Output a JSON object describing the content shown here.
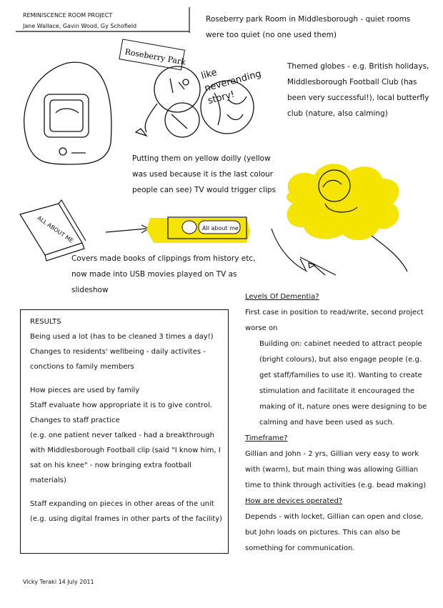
{
  "header": {
    "title": "REMINISCENCE ROOM PROJECT",
    "authors": "Jane Wallace, Gavin Wood, Gy Schofield"
  },
  "intro": "Roseberry park Room in Middlesborough - quiet rooms were too quiet (no one used them)",
  "sign_label": "Roseberry Park",
  "exclaim": "like neverending story!",
  "globes_note": "Themed globes - e.g. British holidays, Middlesborough Football Club (has been very successful!), local butterfly club (nature, also calming)",
  "doily_note": "Putting them on yellow doilly (yellow was used because it is the last colour people can see) TV would trigger clips",
  "book_label": "ALL ABOUT ME",
  "usb_label": "All about me",
  "covers_note": "Covers made books of clippings from history etc, now made into USB movies played on TV as slideshow",
  "results": {
    "heading": "RESULTS",
    "lines": [
      "Being used a lot (has to be cleaned 3 times a day!)",
      "Changes to residents' wellbeing - daily activites - conctions to family members",
      "",
      "How pieces are used by family",
      "Staff evaluate how appropriate it is to give control.",
      "Changes to staff practice",
      "(e.g. one patient never talked - had a breakthrough with Middlesborough Football clip (said \"I know him, I sat on his knee\" - now bringing extra football materials)",
      "",
      "Staff expanding on pieces in other areas of the unit (e.g. using digital frames in other parts of the facility)"
    ]
  },
  "dementia": {
    "heading": "Levels Of Dementia?",
    "text": "First case in position to read/write, second project worse on",
    "building": "Building on: cabinet needed to attract people (bright colours), but also engage people (e.g. get staff/families to use it). Wanting to create stimulation and facilitate it encouraged the making of it, nature ones were designing to be calming and have been used as such."
  },
  "timeframe": {
    "heading": "Timeframe?",
    "text": "Gillian and John - 2 yrs, Gillian very easy to work with (warm), but main thing was allowing Gillian time to think through activities (e.g. bead making)"
  },
  "devices": {
    "heading": "How are devices operated?",
    "text": "Depends - with locket, Gillian can open and close, but John loads on pictures. This can also be something for communication."
  },
  "footer": "Vicky Teraki 14 July 2011",
  "colors": {
    "accent_yellow": "#f5e400",
    "ink": "#111111"
  }
}
